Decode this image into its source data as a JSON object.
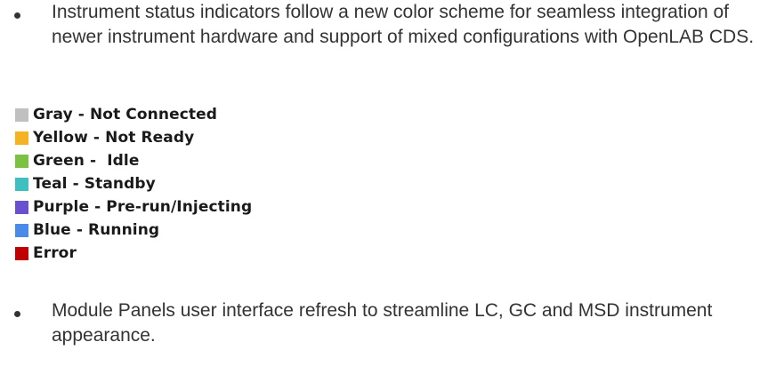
{
  "bullets": [
    {
      "text": "Instrument status indicators follow a new color scheme for seamless integration of newer instrument hardware and support of mixed configurations with OpenLAB CDS."
    },
    {
      "text": "Module Panels user interface refresh to streamline LC, GC and MSD instrument appearance."
    }
  ],
  "legend": [
    {
      "label": "Gray - Not Connected",
      "color": "#c0c0c0"
    },
    {
      "label": "Yellow - Not Ready",
      "color": "#f5b324"
    },
    {
      "label": "Green -  Idle",
      "color": "#7cc242"
    },
    {
      "label": "Teal - Standby",
      "color": "#3fbfbf"
    },
    {
      "label": "Purple - Pre-run/Injecting",
      "color": "#6a4fd1"
    },
    {
      "label": "Blue - Running",
      "color": "#4a8ae8"
    },
    {
      "label": "Error",
      "color": "#c00000"
    }
  ]
}
